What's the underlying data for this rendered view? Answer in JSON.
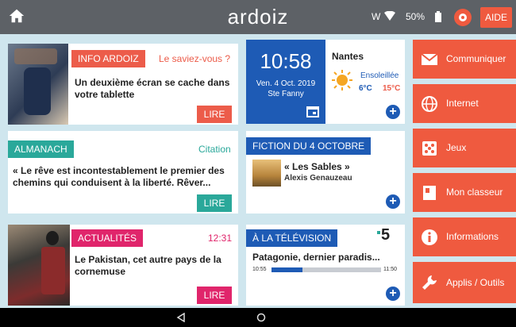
{
  "topbar": {
    "brand": "ardoiz",
    "wifi_label": "W",
    "battery": "50%",
    "help_label": "AIDE"
  },
  "cards": {
    "info": {
      "tag": "INFO ARDOIZ",
      "subtitle": "Le saviez-vous ?",
      "text": "Un deuxième écran se cache dans votre tablette",
      "button": "LIRE"
    },
    "almanach": {
      "tag": "ALMANACH",
      "subtitle": "Citation",
      "text": "« Le rêve est incontestablement le premier des chemins qui conduisent à la liberté. Rêver...",
      "button": "LIRE"
    },
    "actualites": {
      "tag": "ACTUALITÉS",
      "time": "12:31",
      "text": "Le Pakistan, cet autre pays de la cornemuse",
      "button": "LIRE"
    },
    "clock": {
      "time": "10:58",
      "date": "Ven. 4 Oct. 2019",
      "saint": "Ste Fanny"
    },
    "weather": {
      "city": "Nantes",
      "condition": "Ensoleillée",
      "min": "6°C",
      "max": "15°C"
    },
    "fiction": {
      "tag": "FICTION DU 4 OCTOBRE",
      "title": "« Les Sables »",
      "author": "Alexis Genauzeau"
    },
    "tv": {
      "tag": "À LA TÉLÉVISION",
      "channel": "5",
      "program": "Patagonie, dernier paradis...",
      "start": "10:55",
      "end": "11:50",
      "progress": 0.28
    }
  },
  "menu": [
    {
      "label": "Communiquer",
      "icon": "mail-icon"
    },
    {
      "label": "Internet",
      "icon": "globe-icon"
    },
    {
      "label": "Jeux",
      "icon": "dice-icon"
    },
    {
      "label": "Mon classeur",
      "icon": "binder-icon"
    },
    {
      "label": "Informations",
      "icon": "info-icon"
    },
    {
      "label": "Applis / Outils",
      "icon": "wrench-icon"
    }
  ],
  "colors": {
    "accent": "#ef5a3f",
    "info_red": "#ec5c4a",
    "teal": "#2aa89a",
    "pink": "#e0256b",
    "navy": "#1e5bb5",
    "background": "#cfe6ee"
  }
}
